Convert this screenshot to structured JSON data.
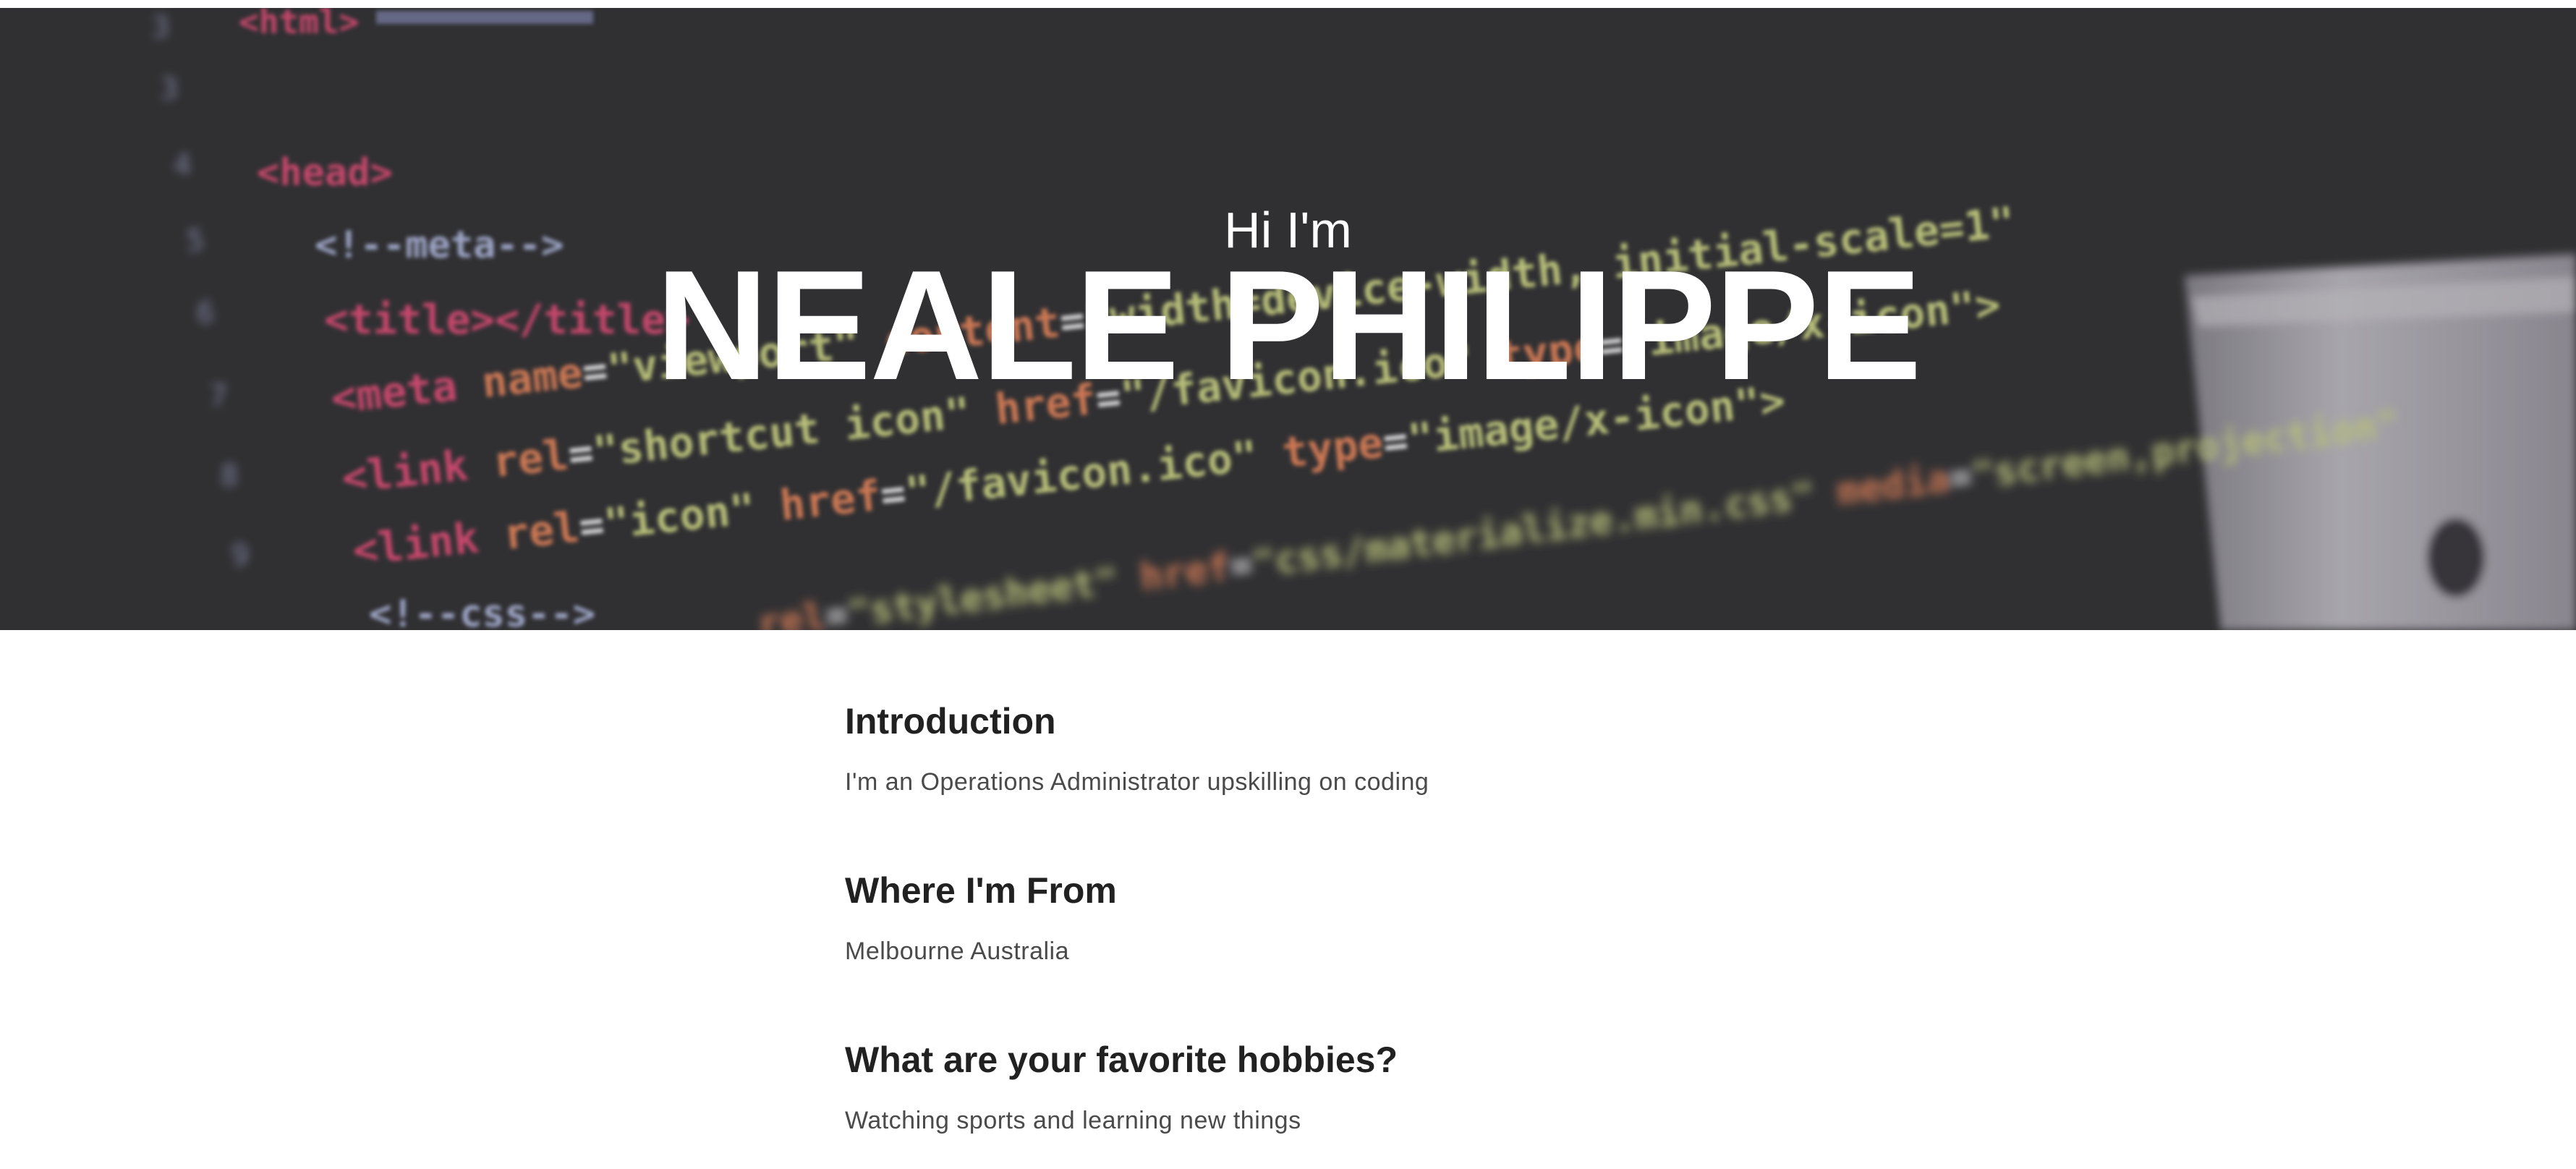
{
  "hero": {
    "greeting": "Hi I'm",
    "name": "NEALE PHILIPPE",
    "background_image": "blurred-code-editor-photo",
    "background_code_lines": [
      "<html>",
      "<head>",
      "<!--meta-->",
      "<title></title>",
      "<meta name=\"viewport\" content=\"width=device-width, initial-scale=1\">",
      "<link rel=\"shortcut icon\" href=\"/favicon.ico\" type=\"image/x-icon\">",
      "<link rel=\"icon\" href=\"/favicon.ico\" type=\"image/x-icon\">",
      "<!--css-->",
      "<link rel=\"stylesheet\" href=\"css/materialize.min.css\" media=\"screen,projection\">"
    ]
  },
  "sections": [
    {
      "heading": "Introduction",
      "body": "I'm an Operations Administrator upskilling on coding"
    },
    {
      "heading": "Where I'm From",
      "body": "Melbourne Australia"
    },
    {
      "heading": "What are your favorite hobbies?",
      "body": "Watching sports and learning new things"
    }
  ],
  "colors": {
    "hero_background": "#323234",
    "heading_text": "#212121",
    "body_text": "#4a4a4a",
    "code_pink": "#e8507a",
    "code_green": "#d8e08a",
    "code_orange": "#f08a5d",
    "code_blue": "#b9c2e8"
  }
}
